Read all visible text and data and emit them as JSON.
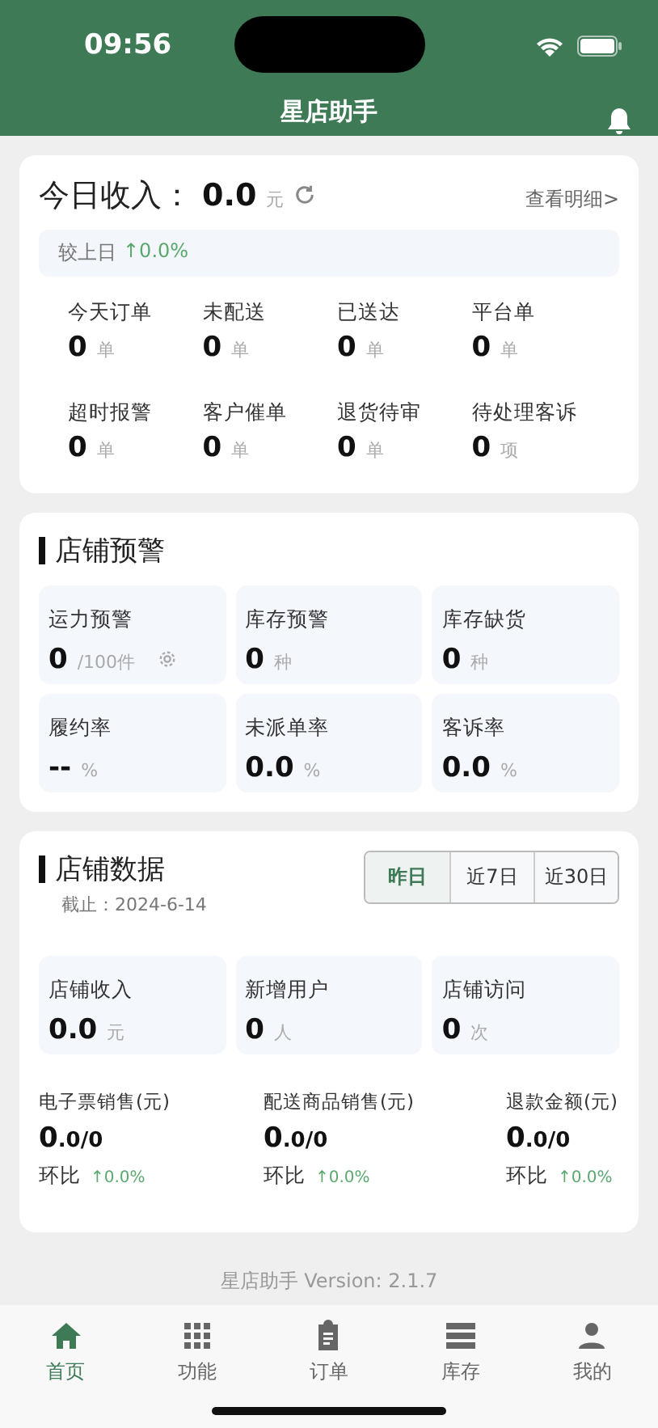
{
  "status_bar": {
    "time": "09:56"
  },
  "header": {
    "title": "星店助手"
  },
  "income": {
    "label": "今日收入：",
    "value": "0.0",
    "unit": "元",
    "detail_link": "查看明细>",
    "compare_label": "较上日",
    "compare_value": "↑0.0%"
  },
  "order_stats": [
    {
      "label": "今天订单",
      "value": "0",
      "unit": "单"
    },
    {
      "label": "未配送",
      "value": "0",
      "unit": "单"
    },
    {
      "label": "已送达",
      "value": "0",
      "unit": "单"
    },
    {
      "label": "平台单",
      "value": "0",
      "unit": "单"
    },
    {
      "label": "超时报警",
      "value": "0",
      "unit": "单"
    },
    {
      "label": "客户催单",
      "value": "0",
      "unit": "单"
    },
    {
      "label": "退货待审",
      "value": "0",
      "unit": "单"
    },
    {
      "label": "待处理客诉",
      "value": "0",
      "unit": "项"
    }
  ],
  "warning": {
    "title": "店铺预警",
    "items": [
      {
        "label": "运力预警",
        "value": "0",
        "unit": "/100件",
        "settings": true
      },
      {
        "label": "库存预警",
        "value": "0",
        "unit": "种",
        "settings": false
      },
      {
        "label": "库存缺货",
        "value": "0",
        "unit": "种",
        "settings": false
      },
      {
        "label": "履约率",
        "value": "--",
        "unit": "%",
        "settings": false
      },
      {
        "label": "未派单率",
        "value": "0.0",
        "unit": "%",
        "settings": false
      },
      {
        "label": "客诉率",
        "value": "0.0",
        "unit": "%",
        "settings": false
      }
    ]
  },
  "store_data": {
    "title": "店铺数据",
    "as_of": "截止：2024-6-14",
    "ranges": [
      {
        "label": "昨日",
        "selected": true
      },
      {
        "label": "近7日",
        "selected": false
      },
      {
        "label": "近30日",
        "selected": false
      }
    ],
    "boxes": [
      {
        "label": "店铺收入",
        "value": "0.0",
        "unit": "元"
      },
      {
        "label": "新增用户",
        "value": "0",
        "unit": "人"
      },
      {
        "label": "店铺访问",
        "value": "0",
        "unit": "次"
      }
    ],
    "sales": [
      {
        "label": "电子票销售(元)",
        "value": "0",
        "sub": ".0/0",
        "ratio_label": "环比",
        "ratio": "↑0.0%"
      },
      {
        "label": "配送商品销售(元)",
        "value": "0",
        "sub": ".0/0",
        "ratio_label": "环比",
        "ratio": "↑0.0%"
      },
      {
        "label": "退款金额(元)",
        "value": "0",
        "sub": ".0/0",
        "ratio_label": "环比",
        "ratio": "↑0.0%"
      }
    ]
  },
  "version": "星店助手 Version: 2.1.7",
  "tabs": [
    {
      "label": "首页",
      "kind": "home",
      "selected": true
    },
    {
      "label": "功能",
      "kind": "grid",
      "selected": false
    },
    {
      "label": "订单",
      "kind": "clipboard",
      "selected": false
    },
    {
      "label": "库存",
      "kind": "list",
      "selected": false
    },
    {
      "label": "我的",
      "kind": "user",
      "selected": false
    }
  ]
}
